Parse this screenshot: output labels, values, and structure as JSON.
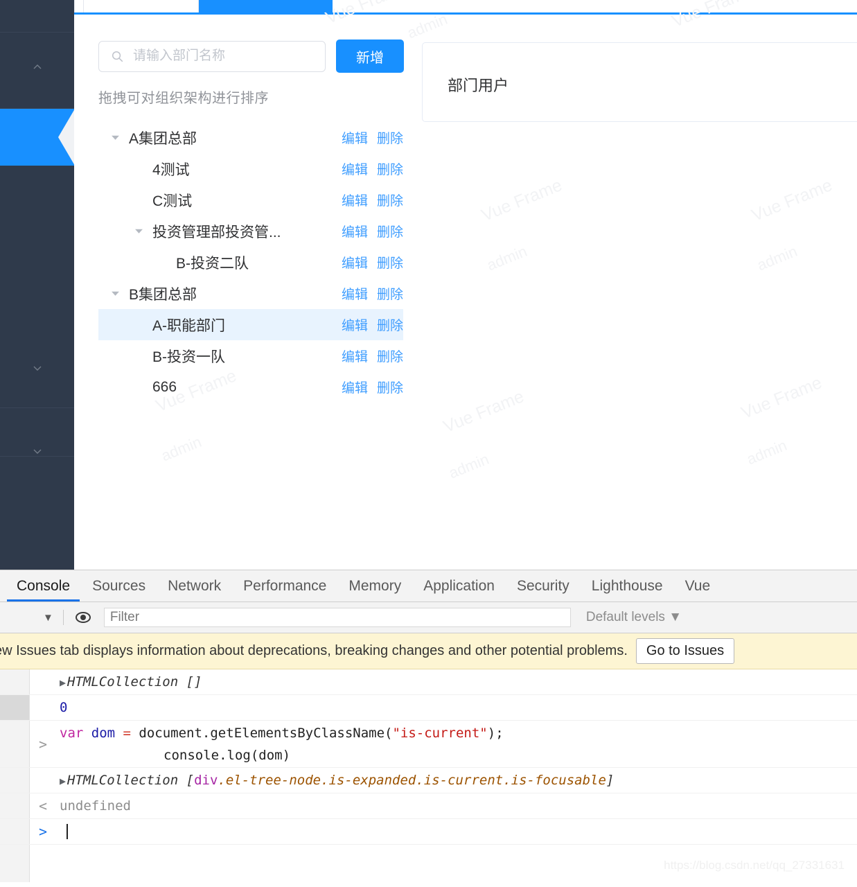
{
  "sidebar": {
    "items": [
      {
        "name": "sidebar-item-top",
        "icon": ""
      },
      {
        "name": "sidebar-item-collapse-up",
        "icon": "chevron-up-icon"
      },
      {
        "name": "sidebar-item-active",
        "icon": ""
      },
      {
        "name": "sidebar-item-blank",
        "icon": ""
      },
      {
        "name": "sidebar-item-collapse-down",
        "icon": "chevron-down-icon"
      },
      {
        "name": "sidebar-item-bottom",
        "icon": "chevron-down-icon"
      }
    ],
    "accent_color": "#1890ff",
    "background_color": "#2f3a4b"
  },
  "tabstrip": {
    "active_tab_color": "#1890ff",
    "underline_color": "#1890ff"
  },
  "watermark": {
    "line1": "Vue Frame",
    "line2": "admin"
  },
  "dept_panel": {
    "search": {
      "placeholder": "请输入部门名称",
      "value": "",
      "icon": "search-icon"
    },
    "add_button": "新增",
    "drag_hint": "拖拽可对组织架构进行排序",
    "ops": {
      "edit": "编辑",
      "delete": "删除"
    },
    "link_color": "#409eff",
    "current_highlight_color": "#e8f3fe",
    "tree": [
      {
        "label": "A集团总部",
        "level": 0,
        "expandable": true,
        "expanded": true,
        "current": false
      },
      {
        "label": "4测试",
        "level": 1,
        "expandable": false,
        "expanded": false,
        "current": false
      },
      {
        "label": "C测试",
        "level": 1,
        "expandable": false,
        "expanded": false,
        "current": false
      },
      {
        "label": "投资管理部投资管...",
        "level": 1,
        "expandable": true,
        "expanded": true,
        "current": false
      },
      {
        "label": "B-投资二队",
        "level": 2,
        "expandable": false,
        "expanded": false,
        "current": false
      },
      {
        "label": "B集团总部",
        "level": 0,
        "expandable": true,
        "expanded": true,
        "current": false
      },
      {
        "label": "A-职能部门",
        "level": 1,
        "expandable": false,
        "expanded": false,
        "current": true
      },
      {
        "label": "B-投资一队",
        "level": 1,
        "expandable": false,
        "expanded": false,
        "current": false
      },
      {
        "label": "666",
        "level": 1,
        "expandable": false,
        "expanded": false,
        "current": false
      }
    ]
  },
  "user_card": {
    "title": "部门用户"
  },
  "devtools": {
    "tabs": [
      {
        "label": "Console",
        "active": true
      },
      {
        "label": "Sources",
        "active": false
      },
      {
        "label": "Network",
        "active": false
      },
      {
        "label": "Performance",
        "active": false
      },
      {
        "label": "Memory",
        "active": false
      },
      {
        "label": "Application",
        "active": false
      },
      {
        "label": "Security",
        "active": false
      },
      {
        "label": "Lighthouse",
        "active": false
      },
      {
        "label": "Vue",
        "active": false
      }
    ],
    "filterbar": {
      "caret": "▼",
      "eye_icon": "eye-icon",
      "filter_placeholder": "Filter",
      "filter_value": "",
      "levels_label": "Default levels ▼"
    },
    "banner": {
      "text": "ew Issues tab displays information about deprecations, breaking changes and other potential problems.",
      "button": "Go to Issues",
      "background_color": "#fdf5d3"
    },
    "console_lines": {
      "l1_object": "HTMLCollection []",
      "l2_number": "0",
      "l3_code_part1": "var",
      "l3_code_part2": " dom ",
      "l3_code_part3": "= ",
      "l3_code_part4": "document.getElementsByClassName(",
      "l3_code_str": "\"is-current\"",
      "l3_code_part5": ");",
      "l3_code_line2": "console.log(dom)",
      "l4_object_prefix": "HTMLCollection [",
      "l4_object_div": "div",
      "l4_object_classes": ".el-tree-node.is-expanded.is-current.is-focusable",
      "l4_object_suffix": "]",
      "l5_undefined": "undefined",
      "input_marker": ">",
      "output_marker": "<"
    }
  },
  "page_watermark": "https://blog.csdn.net/qq_27331631"
}
